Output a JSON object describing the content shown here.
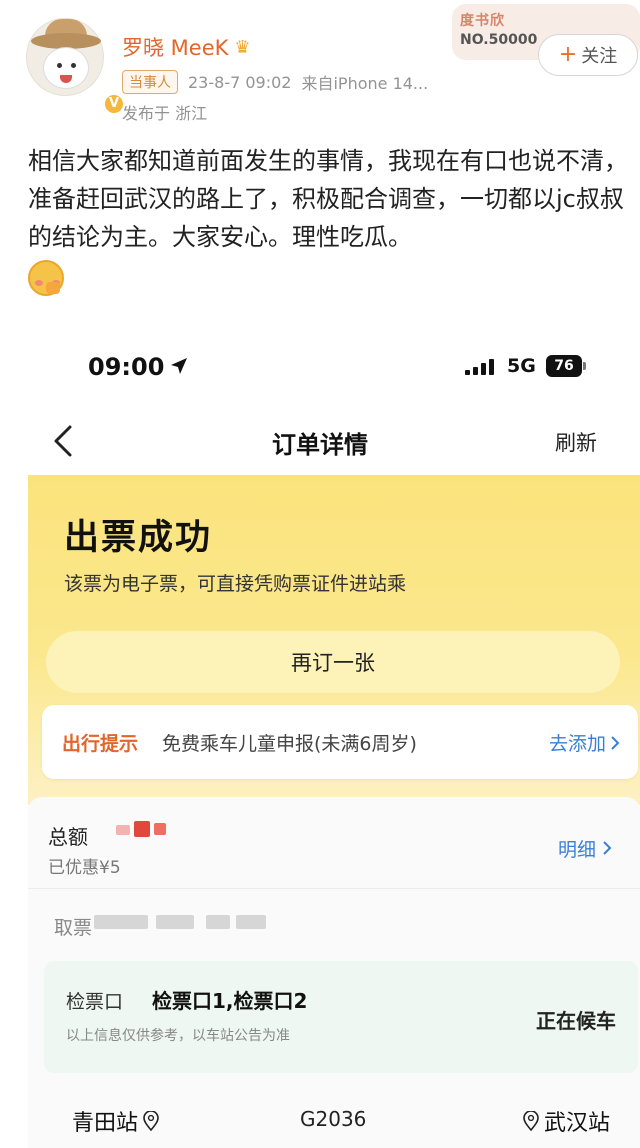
{
  "post": {
    "username": "罗晓 MeeK",
    "role_tag": "当事人",
    "time": "23-8-7 09:02",
    "source": "来自iPhone 14...",
    "location": "发布于 浙江",
    "stamp_title": "度书欣",
    "stamp_no": "NO.50000",
    "follow_label": "关注",
    "text": "相信大家都知道前面发生的事情，我现在有口也说不清，准备赶回武汉的路上了，积极配合调查，一切都以jc叔叔的结论为主。大家安心。理性吃瓜。"
  },
  "phone": {
    "status_time": "09:00",
    "network": "5G",
    "battery": "76",
    "nav": {
      "title": "订单详情",
      "refresh": "刷新"
    },
    "success": {
      "title": "出票成功",
      "subtitle": "该票为电子票，可直接凭购票证件进站乘",
      "rebook_label": "再订一张"
    },
    "tip": {
      "label": "出行提示",
      "text": "免费乘车儿童申报(未满6周岁)",
      "action": "去添加"
    },
    "order": {
      "amount_label": "总额",
      "discount": "已优惠¥5",
      "detail_link": "明细",
      "pickup_label": "取票",
      "gate_label": "检票口",
      "gate_value": "检票口1,检票口2",
      "gate_note": "以上信息仅供参考，以车站公告为准",
      "status": "正在候车",
      "from": "青田站",
      "train_no": "G2036",
      "to": "武汉站"
    }
  },
  "colors": {
    "username": "#e3662b",
    "accent_orange": "#e2662c",
    "link_blue": "#3a7fd6",
    "panel_yellow": "#fbe37c",
    "gate_green": "#eef7f1"
  },
  "icons": [
    "crown-icon",
    "verified-badge-icon",
    "plus-icon",
    "laugh-emoji-icon",
    "location-arrow-icon",
    "signal-icon",
    "back-chevron-icon",
    "chevron-right-icon",
    "map-pin-icon"
  ]
}
